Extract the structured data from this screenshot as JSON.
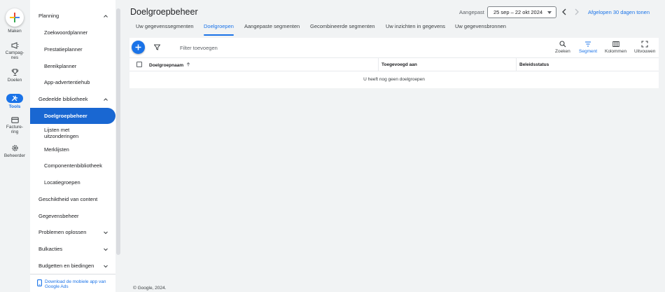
{
  "rail": {
    "make_label": "Maken",
    "items": [
      {
        "label_1": "Campag-",
        "label_2": "nes",
        "icon": "megaphone-icon"
      },
      {
        "label_1": "Doelen",
        "label_2": "",
        "icon": "trophy-icon"
      },
      {
        "label_1": "Tools",
        "label_2": "",
        "icon": "tools-icon"
      },
      {
        "label_1": "Facture-",
        "label_2": "ring",
        "icon": "credit-card-icon"
      },
      {
        "label_1": "Beheerder",
        "label_2": "",
        "icon": "gear-icon"
      }
    ]
  },
  "nav": {
    "items": [
      {
        "label": "Planning",
        "type": "group",
        "expanded": true
      },
      {
        "label": "Zoekwoordplanner",
        "type": "sub"
      },
      {
        "label": "Prestatieplanner",
        "type": "sub"
      },
      {
        "label": "Bereikplanner",
        "type": "sub"
      },
      {
        "label": "App-advertentiehub",
        "type": "sub"
      },
      {
        "label": "Gedeelde bibliotheek",
        "type": "group",
        "expanded": true
      },
      {
        "label": "Doelgroepbeheer",
        "type": "sub",
        "active": true
      },
      {
        "label_1": "Lijsten met",
        "label_2": "uitzonderingen",
        "type": "sub"
      },
      {
        "label": "Merklijsten",
        "type": "sub"
      },
      {
        "label": "Componentenbibliotheek",
        "type": "sub"
      },
      {
        "label": "Locatiegroepen",
        "type": "sub"
      },
      {
        "label": "Geschiktheid van content",
        "type": "group"
      },
      {
        "label": "Gegevensbeheer",
        "type": "group"
      },
      {
        "label": "Problemen oplossen",
        "type": "group",
        "expanded": false
      },
      {
        "label": "Bulkacties",
        "type": "group",
        "expanded": false
      },
      {
        "label": "Budgetten en biedingen",
        "type": "group",
        "expanded": false
      }
    ],
    "download_1": "Download de mobiele app van",
    "download_2": "Google Ads"
  },
  "header": {
    "title": "Doelgroepbeheer",
    "date_label": "Aangepast",
    "date_range": "25 sep – 22 okt 2024",
    "last30": "Afgelopen 30 dagen tonen"
  },
  "tabs": [
    "Uw gegevenssegmenten",
    "Doelgroepen",
    "Aangepaste segmenten",
    "Gecombineerde segmenten",
    "Uw inzichten in gegevens",
    "Uw gegevensbronnen"
  ],
  "active_tab": 1,
  "toolbar": {
    "filter_placeholder": "Filter toevoegen",
    "tools": [
      "Zoeken",
      "Segment",
      "Kolommen",
      "Uitvouwen"
    ]
  },
  "table": {
    "columns": [
      "Doelgroepnaam",
      "Toegevoegd aan",
      "Beleidsstatus"
    ],
    "empty_message": "U heeft nog geen doelgroepen"
  },
  "footer": {
    "copyright": "© Google, 2024."
  },
  "colors": {
    "accent": "#1a73e8",
    "active_nav": "#1967d2"
  }
}
